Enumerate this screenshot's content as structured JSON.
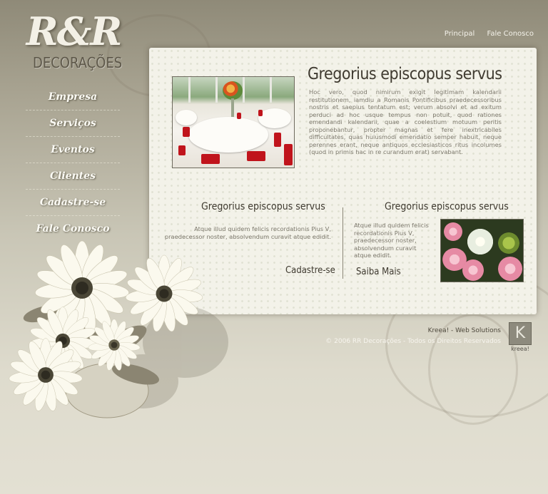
{
  "colors": {
    "background_top": "#8f8a78",
    "background_bottom": "#e3e0d3",
    "panel": "#f3f2e9",
    "heading_text": "#3f3a30",
    "body_text": "#7c786c",
    "chair_red": "#c0141c"
  },
  "logo": {
    "mark": "R&R",
    "subtitle": "DECORAÇÕES"
  },
  "top_nav": {
    "items": [
      "Principal",
      "Fale Conosco"
    ]
  },
  "side_nav": {
    "items": [
      "Empresa",
      "Serviços",
      "Eventos",
      "Clientes",
      "Cadastre-se",
      "Fale Conosco"
    ]
  },
  "main": {
    "title": "Gregorius episcopus servus",
    "text": "Hoc vero, quod nimirum exigit legitimam kalendarii restitutionem, iamdiu a Romanis Pontificibus praedecessoribus nostris et saepius tentatum est; verum absolvi et ad exitum perduci ad hoc usque tempus non potuit, quod rationes emendandi kalendarii, quae a coelestium motuum peritis proponebantur, propter magnas et fere inextricabiles difficultates, quas huiusmodi emendatio semper habuit, neque perennes erant, neque antiquos ecclesiasticos ritus incolumes (quod in primis hac in re curandum erat) servabant."
  },
  "left_column": {
    "title": "Gregorius episcopus servus",
    "text": "Atque illud quidem felicis recordationis Pius V, praedecessor noster, absolvendum curavit atque edidit.",
    "link": "Cadastre-se"
  },
  "right_column": {
    "title": "Gregorius episcopus servus",
    "text": "Atque illud quidem felicis recordationis Pius V, praedecessor noster, absolvendum curavit atque edidit.",
    "link": "Saiba Mais"
  },
  "footer": {
    "credit": "Kreea! - Web Solutions",
    "copyright": "© 2006 RR Decorações - Todos os Direitos Reservados",
    "badge_letter": "K",
    "badge_text": "kreea!"
  }
}
